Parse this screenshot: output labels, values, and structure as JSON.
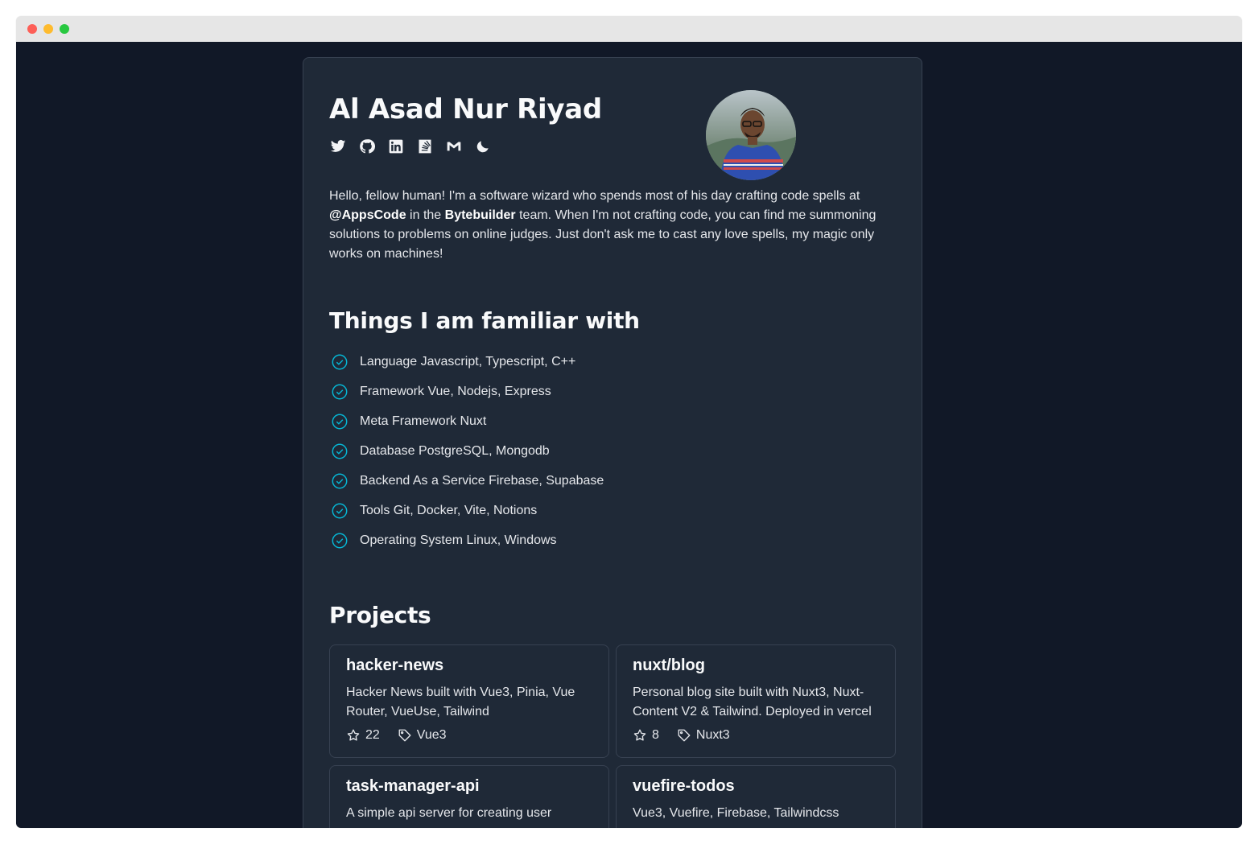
{
  "window": {
    "controls": [
      "close",
      "minimize",
      "maximize"
    ]
  },
  "profile": {
    "name": "Al Asad Nur Riyad",
    "socials": [
      {
        "icon": "twitter-icon"
      },
      {
        "icon": "github-icon"
      },
      {
        "icon": "linkedin-icon"
      },
      {
        "icon": "stackoverflow-icon"
      },
      {
        "icon": "gmail-icon"
      },
      {
        "icon": "moon-icon"
      }
    ],
    "avatar_icon": "avatar"
  },
  "bio": {
    "part1": "Hello, fellow human! I'm a software wizard who spends most of his day crafting code spells at ",
    "company": "@AppsCode",
    "part2": " in the ",
    "team": "Bytebuilder",
    "part3": " team. When I'm not crafting code, you can find me summoning solutions to problems on online judges. Just don't ask me to cast any love spells, my magic only works on machines!"
  },
  "skills": {
    "title": "Things I am familiar with",
    "items": [
      {
        "label": "Language Javascript, Typescript, C++"
      },
      {
        "label": "Framework Vue, Nodejs, Express"
      },
      {
        "label": "Meta Framework Nuxt"
      },
      {
        "label": "Database PostgreSQL, Mongodb"
      },
      {
        "label": "Backend As a Service Firebase, Supabase"
      },
      {
        "label": "Tools Git, Docker, Vite, Notions"
      },
      {
        "label": "Operating System Linux, Windows"
      }
    ]
  },
  "projects": {
    "title": "Projects",
    "items": [
      {
        "name": "hacker-news",
        "description": "Hacker News built with Vue3, Pinia, Vue Router, VueUse, Tailwind",
        "stars": "22",
        "tag": "Vue3"
      },
      {
        "name": "nuxt/blog",
        "description": "Personal blog site built with Nuxt3, Nuxt-Content V2 & Tailwind. Deployed in vercel",
        "stars": "8",
        "tag": "Nuxt3"
      },
      {
        "name": "task-manager-api",
        "description": "A simple api server for creating user",
        "stars": "",
        "tag": ""
      },
      {
        "name": "vuefire-todos",
        "description": "Vue3, Vuefire, Firebase, Tailwindcss",
        "stars": "",
        "tag": ""
      }
    ]
  },
  "colors": {
    "background": "#111827",
    "card": "#1f2937",
    "border": "#374151",
    "accent": "#06b6d4"
  }
}
